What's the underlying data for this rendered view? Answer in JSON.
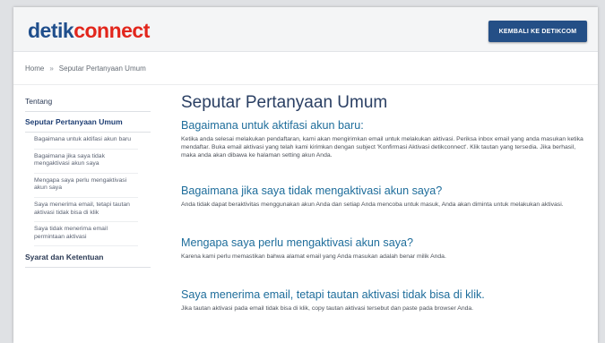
{
  "header": {
    "logo_part1": "detik",
    "logo_part2": "connect",
    "back_button": "KEMBALI KE DETIKCOM"
  },
  "breadcrumb": {
    "home": "Home",
    "separator": "»",
    "current": "Seputar Pertanyaan Umum"
  },
  "sidebar": {
    "tentang": "Tentang",
    "active": "Seputar Pertanyaan Umum",
    "sub_items": [
      "Bagaimana untuk aktifasi akun baru",
      "Bagaimana jika saya tidak mengaktivasi akun saya",
      "Mengapa saya perlu mengaktivasi akun saya",
      "Saya menerima email, tetapi tautan aktivasi tidak bisa di klik",
      "Saya tidak menerima email permintaan aktivasi"
    ],
    "syarat": "Syarat dan Ketentuan"
  },
  "main": {
    "title": "Seputar Pertanyaan Umum",
    "faqs": [
      {
        "question": "Bagaimana untuk aktifasi akun baru:",
        "answer": "Ketika anda selesai melakukan pendaftaran, kami akan mengirimkan email untuk melakukan aktivasi. Periksa inbox email yang anda masukan ketika mendaftar. Buka email aktivasi yang telah kami kirimkan dengan subject 'Konfirmasi Aktivasi detikconnect'. Klik tautan yang tersedia. Jika berhasil, maka anda akan dibawa ke halaman setting akun Anda."
      },
      {
        "question": "Bagaimana jika saya tidak mengaktivasi akun saya?",
        "answer": "Anda tidak dapat beraktivitas menggunakan akun Anda dan setiap Anda mencoba untuk masuk, Anda akan diminta untuk melakukan aktivasi."
      },
      {
        "question": "Mengapa saya perlu mengaktivasi akun saya?",
        "answer": "Karena kami perlu memastikan bahwa alamat email yang Anda masukan adalah benar milik Anda."
      },
      {
        "question": "Saya menerima email, tetapi tautan aktivasi tidak bisa di klik.",
        "answer": "Jika tautan aktivasi pada email tidak bisa di klik, copy tautan aktivasi tersebut dan paste pada browser Anda."
      }
    ]
  },
  "colors": {
    "brand_blue": "#1f4e8c",
    "brand_red": "#e2261c",
    "button_bg": "#244f86",
    "question_blue": "#1e6d9b"
  }
}
